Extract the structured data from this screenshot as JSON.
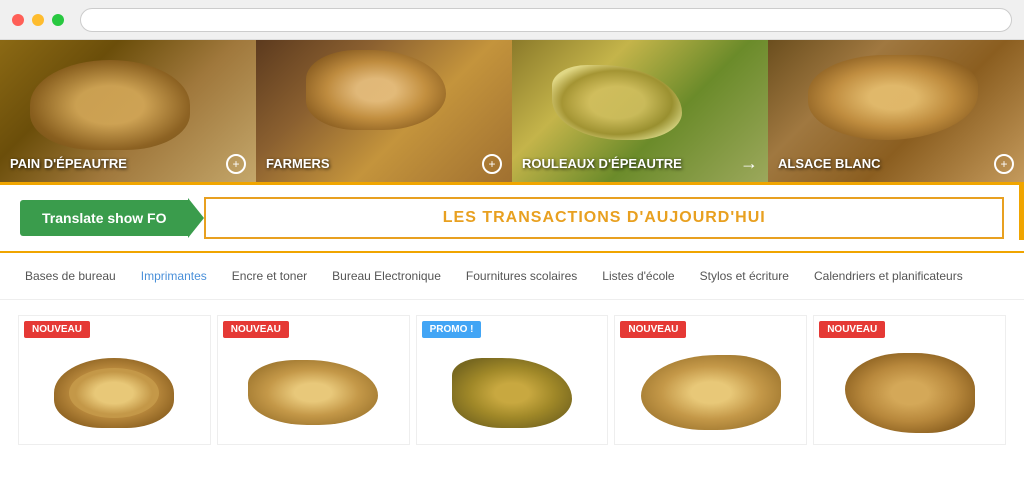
{
  "browser": {
    "traffic_lights": [
      "red",
      "yellow",
      "green"
    ]
  },
  "banners": [
    {
      "id": "banner-1",
      "label": "PAIN D'ÉPEAUTRE",
      "icon": "+",
      "has_arrow": false
    },
    {
      "id": "banner-2",
      "label": "FARMERS",
      "icon": "+",
      "has_arrow": false
    },
    {
      "id": "banner-3",
      "label": "ROULEAUX D'ÉPEAUTRE",
      "icon": "→",
      "has_arrow": true
    },
    {
      "id": "banner-4",
      "label": "ALSACE BLANC",
      "icon": "+",
      "has_arrow": false
    }
  ],
  "action_bar": {
    "translate_btn": "Translate show FO",
    "transactions_label": "LES TRANSACTIONS D'AUJOURD'HUI"
  },
  "categories": [
    {
      "id": "bases-bureau",
      "label": "Bases de bureau",
      "active": false
    },
    {
      "id": "imprimantes",
      "label": "Imprimantes",
      "active": true
    },
    {
      "id": "encre-toner",
      "label": "Encre et toner",
      "active": false
    },
    {
      "id": "bureau-electronique",
      "label": "Bureau Electronique",
      "active": false
    },
    {
      "id": "fournitures-scolaires",
      "label": "Fournitures scolaires",
      "active": false
    },
    {
      "id": "listes-ecole",
      "label": "Listes d'école",
      "active": false
    },
    {
      "id": "stylos-ecriture",
      "label": "Stylos et écriture",
      "active": false
    },
    {
      "id": "calendriers",
      "label": "Calendriers et planificateurs",
      "active": false
    }
  ],
  "products": [
    {
      "id": "prod-1",
      "badge": "NOUVEAU",
      "badge_type": "nouveau"
    },
    {
      "id": "prod-2",
      "badge": "NOUVEAU",
      "badge_type": "nouveau"
    },
    {
      "id": "prod-3",
      "badge": "PROMO !",
      "badge_type": "promo"
    },
    {
      "id": "prod-4",
      "badge": "NOUVEAU",
      "badge_type": "nouveau"
    },
    {
      "id": "prod-5",
      "badge": "NOUVEAU",
      "badge_type": "nouveau"
    }
  ]
}
